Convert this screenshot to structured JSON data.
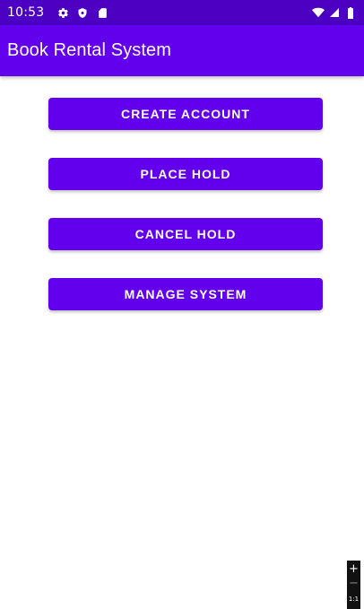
{
  "status_bar": {
    "time": "10:53",
    "left_icons": [
      "settings-icon",
      "shield-icon",
      "sd-card-icon"
    ],
    "right_icons": [
      "wifi-icon",
      "signal-icon",
      "battery-icon"
    ]
  },
  "app_bar": {
    "title": "Book Rental System"
  },
  "buttons": {
    "create_account": "CREATE ACCOUNT",
    "place_hold": "PLACE HOLD",
    "cancel_hold": "CANCEL HOLD",
    "manage_system": "MANAGE SYSTEM"
  },
  "zoom": {
    "plus": "+",
    "minus": "−",
    "level": "1:1"
  },
  "colors": {
    "status_bar": "#4b00c2",
    "primary": "#6200ee",
    "background": "#ffffff",
    "on_primary": "#ffffff"
  }
}
